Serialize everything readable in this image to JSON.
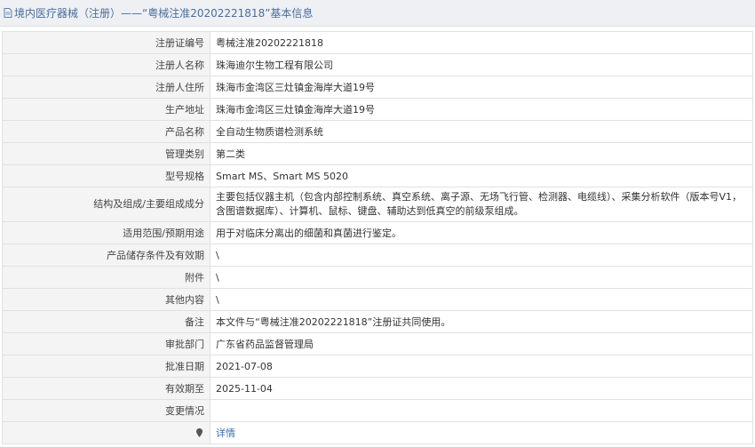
{
  "header": {
    "title": "境内医疗器械（注册）——“粤械注准20202221818”基本信息"
  },
  "rows": [
    {
      "label": "注册证编号",
      "value": "粤械注准20202221818"
    },
    {
      "label": "注册人名称",
      "value": "珠海迪尔生物工程有限公司"
    },
    {
      "label": "注册人住所",
      "value": "珠海市金湾区三灶镇金海岸大道19号"
    },
    {
      "label": "生产地址",
      "value": "珠海市金湾区三灶镇金海岸大道19号"
    },
    {
      "label": "产品名称",
      "value": "全自动生物质谱检测系统"
    },
    {
      "label": "管理类别",
      "value": "第二类"
    },
    {
      "label": "型号规格",
      "value": "Smart MS、Smart MS 5020"
    },
    {
      "label": "结构及组成/主要组成成分",
      "value": "主要包括仪器主机（包含内部控制系统、真空系统、离子源、无场飞行管、检测器、电缆线）、采集分析软件（版本号V1，含图谱数据库）、计算机、鼠标、键盘、辅助达到低真空的前级泵组成。"
    },
    {
      "label": "适用范围/预期用途",
      "value": "用于对临床分离出的细菌和真菌进行鉴定。"
    },
    {
      "label": "产品储存条件及有效期",
      "value": "\\"
    },
    {
      "label": "附件",
      "value": "\\"
    },
    {
      "label": "其他内容",
      "value": "\\"
    },
    {
      "label": "备注",
      "value": "本文件与“粤械注准20202221818”注册证共同使用。"
    },
    {
      "label": "审批部门",
      "value": "广东省药品监督管理局"
    },
    {
      "label": "批准日期",
      "value": "2021-07-08"
    },
    {
      "label": "有效期至",
      "value": "2025-11-04"
    },
    {
      "label": "变更情况",
      "value": ""
    }
  ],
  "footer_row": {
    "label": "",
    "link": "详情"
  },
  "colors": {
    "header_bg": "#eef0f3",
    "title_text": "#4b6d9c",
    "label_bg": "#f4f4f4",
    "link": "#3a6fb6"
  },
  "icons": {
    "title": "document-icon",
    "footer": "map-pin-icon"
  }
}
